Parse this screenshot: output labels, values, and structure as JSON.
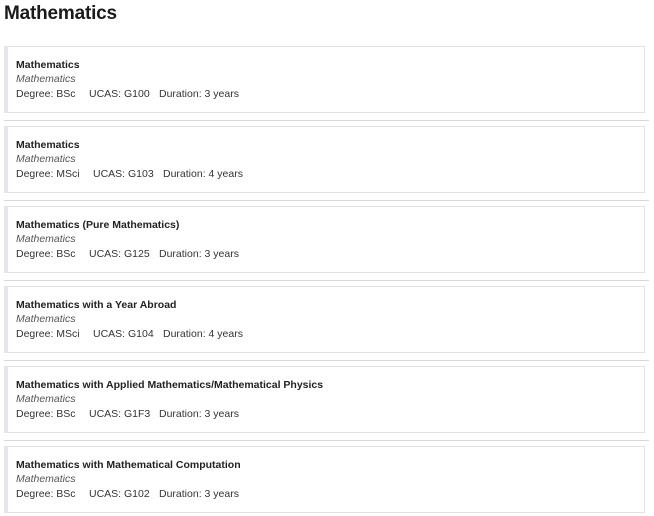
{
  "page": {
    "title": "Mathematics"
  },
  "labels": {
    "degree": "Degree:",
    "ucas": "UCAS:",
    "duration": "Duration:"
  },
  "courses": [
    {
      "title": "Mathematics",
      "subject": "Mathematics",
      "degree": "Degree: BSc",
      "ucas": "UCAS: G100",
      "duration": "Duration: 3 years"
    },
    {
      "title": "Mathematics",
      "subject": "Mathematics",
      "degree": "Degree: MSci",
      "ucas": "UCAS: G103",
      "duration": "Duration: 4 years"
    },
    {
      "title": "Mathematics (Pure Mathematics)",
      "subject": "Mathematics",
      "degree": "Degree: BSc",
      "ucas": "UCAS: G125",
      "duration": "Duration: 3 years"
    },
    {
      "title": "Mathematics with a Year Abroad",
      "subject": "Mathematics",
      "degree": "Degree: MSci",
      "ucas": "UCAS: G104",
      "duration": "Duration: 4 years"
    },
    {
      "title": "Mathematics with Applied Mathematics/Mathematical Physics",
      "subject": "Mathematics",
      "degree": "Degree: BSc",
      "ucas": "UCAS: G1F3",
      "duration": "Duration: 3 years"
    },
    {
      "title": "Mathematics with Mathematical Computation",
      "subject": "Mathematics",
      "degree": "Degree: BSc",
      "ucas": "UCAS: G102",
      "duration": "Duration: 3 years"
    }
  ],
  "colors": {
    "card_border": "#e2e2e2",
    "card_accent": "#e4e6ec",
    "divider": "#d8d8d8",
    "text": "#222222"
  }
}
